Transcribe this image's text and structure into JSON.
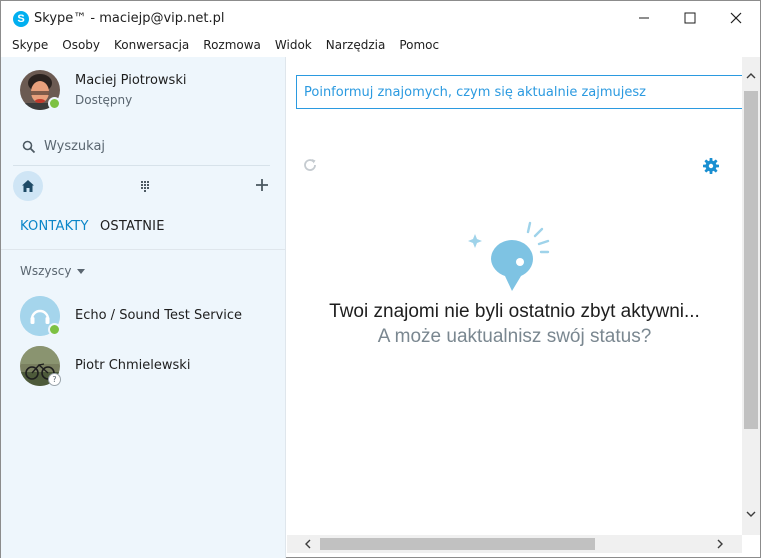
{
  "window": {
    "title": "Skype™ - maciejp@vip.net.pl",
    "app_icon": "skype-icon",
    "controls": [
      "minimize-icon",
      "maximize-icon",
      "close-icon"
    ]
  },
  "menubar": {
    "items": [
      "Skype",
      "Osoby",
      "Konwersacja",
      "Rozmowa",
      "Widok",
      "Narzędzia",
      "Pomoc"
    ]
  },
  "profile": {
    "name": "Maciej Piotrowski",
    "status": "Dostępny",
    "presence": "online"
  },
  "search": {
    "label": "Wyszukaj",
    "icon": "search-icon"
  },
  "toolbar": {
    "home_icon": "home-icon",
    "dialpad_icon": "dialpad-icon",
    "add_icon": "add-icon"
  },
  "tabs": [
    {
      "label": "KONTAKTY",
      "active": true
    },
    {
      "label": "OSTATNIE",
      "active": false
    }
  ],
  "filter": {
    "label": "Wszyscy"
  },
  "contacts": [
    {
      "name": "Echo / Sound Test Service",
      "presence": "online"
    },
    {
      "name": "Piotr Chmielewski",
      "presence": "unknown"
    }
  ],
  "main": {
    "mood_placeholder": "Poinformuj znajomych, czym się aktualnie zajmujesz",
    "empty_title": "Twoi znajomi nie byli ostatnio zbyt aktywni...",
    "empty_subtitle": "A może uaktualnisz swój status?"
  },
  "colors": {
    "accent": "#00aff0",
    "link": "#0b86c8",
    "sidebar_bg": "#eef6fc",
    "online": "#7dc142"
  }
}
